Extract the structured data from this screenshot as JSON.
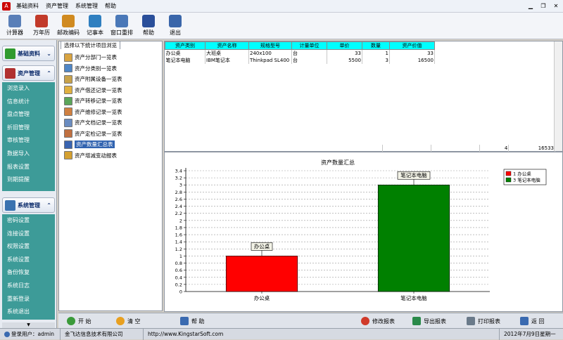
{
  "menu": {
    "items": [
      "基础资料",
      "资产管理",
      "系统管理",
      "帮助"
    ]
  },
  "toolbar": {
    "items": [
      {
        "label": "计算器",
        "icon": "calculator-icon",
        "color": "#5a7fb8"
      },
      {
        "label": "万年历",
        "icon": "calendar-icon",
        "color": "#c23a2a"
      },
      {
        "label": "邮政编码",
        "icon": "mail-icon",
        "color": "#d08a20"
      },
      {
        "label": "记事本",
        "icon": "notepad-icon",
        "color": "#2f7fc0"
      },
      {
        "label": "窗口重排",
        "icon": "window-arrange-icon",
        "color": "#4a78b8"
      },
      {
        "label": "帮助",
        "icon": "help-book-icon",
        "color": "#2a4f9a"
      },
      {
        "label": "退出",
        "icon": "exit-icon",
        "color": "#3a66aa"
      }
    ]
  },
  "sidebar": {
    "basic": {
      "title": "基础资料"
    },
    "asset": {
      "title": "资产管理",
      "items": [
        "浏览录入",
        "信息统计",
        "盘点管理",
        "折旧管理",
        "审核管理",
        "数据导入",
        "报表设置",
        "到期提醒"
      ]
    },
    "system": {
      "title": "系统管理",
      "items": [
        "密码设置",
        "连接设置",
        "权限设置",
        "系统设置",
        "备份恢复",
        "系统日志",
        "重新登录",
        "系统退出"
      ]
    }
  },
  "tree": {
    "tab": "选择以下统计项目浏览",
    "nodes": [
      "资产分部门一览表",
      "资产分类别一览表",
      "资产附属设备一览表",
      "资产借还记录一览表",
      "资产转移记录一览表",
      "资产维修记录一览表",
      "资产文档记录一览表",
      "资产定检记录一览表",
      "资产数量汇总表",
      "资产增减变动报表"
    ],
    "selected_index": 8
  },
  "grid": {
    "columns": [
      "资产类别",
      "资产名称",
      "规格型号",
      "计量单位",
      "单价",
      "数量",
      "资产价值"
    ],
    "rows": [
      [
        "办公桌",
        "大班桌",
        "240x100",
        "台",
        "33",
        "1",
        "33"
      ],
      [
        "笔记本电脑",
        "IBM笔记本",
        "Thinkpad SL400",
        "台",
        "5500",
        "3",
        "16500"
      ]
    ],
    "totals": {
      "qty": "4",
      "value": "16533"
    }
  },
  "chart_data": {
    "type": "bar",
    "title": "资产数量汇总",
    "categories": [
      "办公桌",
      "笔记本电脑"
    ],
    "values": [
      1,
      3
    ],
    "colors": [
      "#ff0000",
      "#008000"
    ],
    "legend": [
      "1 办公桌",
      "3 笔记本电脑"
    ],
    "legend_placement": "top-right",
    "ylim": [
      0,
      3.4
    ],
    "yticks": [
      0,
      0.2,
      0.4,
      0.6,
      0.8,
      1,
      1.2,
      1.4,
      1.6,
      1.8,
      2,
      2.2,
      2.4,
      2.6,
      2.8,
      3,
      3.2,
      3.4
    ],
    "grid": true
  },
  "bottom": {
    "start": "开 始",
    "clear": "清 空",
    "help": "帮 助",
    "edit": "修改报表",
    "export": "导出报表",
    "print": "打印报表",
    "back": "返 回"
  },
  "status": {
    "user": "登录用户：admin",
    "company": "金飞达信息技术有限公司",
    "url": "http://www.KingstarSoft.com",
    "date": "2012年7月9日星期一"
  }
}
